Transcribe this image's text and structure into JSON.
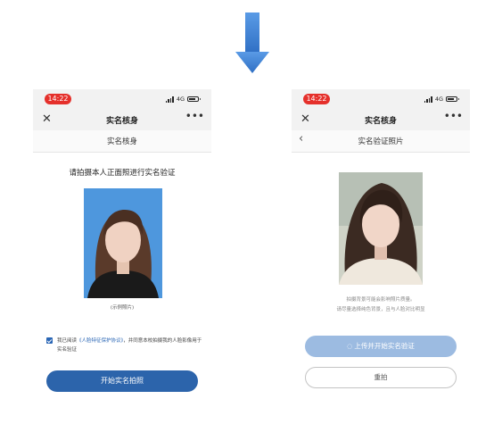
{
  "left_screen": {
    "status": {
      "time": "14:22",
      "network": "4G"
    },
    "nav_title": "实名核身",
    "sub_header": "实名核身",
    "instruction": "请拍摄本人正面照进行实名验证",
    "photo_caption": "(示例照片)",
    "consent": {
      "prefix": "我已阅读",
      "link": "《人脸特征保护协议》",
      "suffix": "，并同意本校拍摄我的人脸影像用于实名验证"
    },
    "start_button": "开始实名拍照"
  },
  "right_screen": {
    "status": {
      "time": "14:22",
      "network": "4G"
    },
    "nav_title": "实名核身",
    "sub_header": "实名验证照片",
    "notice_line1": "拍摄背景可能会影响照片质量。",
    "notice_line2": "请尽量选择纯色背景，且与人脸对比明显",
    "upload_button": "上传并开始实名验证",
    "retake_button": "重拍"
  },
  "colors": {
    "arrow": "#3b7fd3",
    "primary_button": "#2c64ab",
    "disabled_button": "#9cbbe1",
    "time_pill": "#e5302b",
    "photo_background_blue": "#4e97dd"
  }
}
